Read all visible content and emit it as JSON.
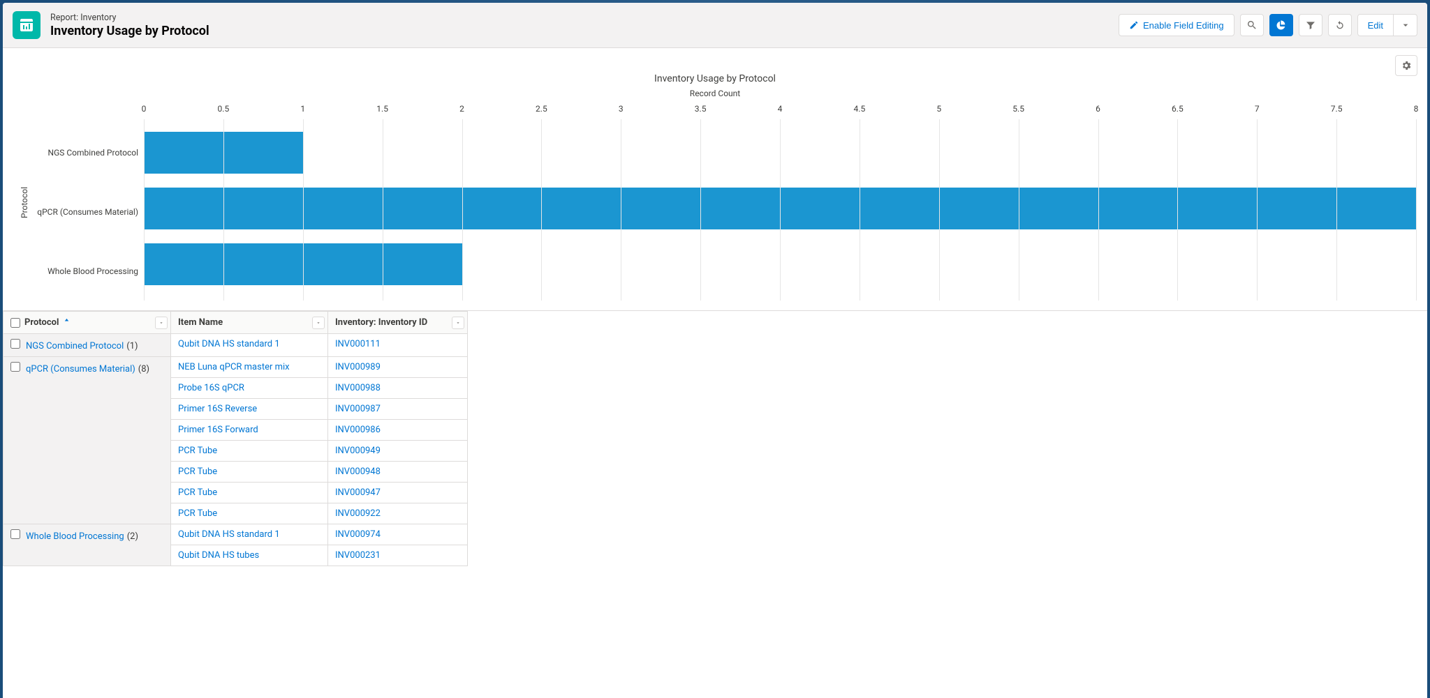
{
  "header": {
    "subtitle": "Report: Inventory",
    "title": "Inventory Usage by Protocol",
    "field_editing_label": "Enable Field Editing",
    "edit_label": "Edit"
  },
  "chart_data": {
    "type": "bar",
    "orientation": "horizontal",
    "title": "Inventory Usage by Protocol",
    "xlabel": "Record Count",
    "ylabel": "Protocol",
    "xlim": [
      0,
      8
    ],
    "ticks": [
      0,
      0.5,
      1,
      1.5,
      2,
      2.5,
      3,
      3.5,
      4,
      4.5,
      5,
      5.5,
      6,
      6.5,
      7,
      7.5,
      8
    ],
    "categories": [
      "NGS Combined Protocol",
      "qPCR (Consumes Material)",
      "Whole Blood Processing"
    ],
    "values": [
      1,
      8,
      2
    ]
  },
  "table": {
    "columns": {
      "protocol": "Protocol",
      "item": "Item Name",
      "inv": "Inventory: Inventory ID"
    },
    "groups": [
      {
        "protocol": "NGS Combined Protocol",
        "count": 1,
        "rows": [
          {
            "item": "Qubit DNA HS standard 1",
            "inv": "INV000111"
          }
        ]
      },
      {
        "protocol": "qPCR (Consumes Material)",
        "count": 8,
        "rows": [
          {
            "item": "NEB Luna qPCR master mix",
            "inv": "INV000989"
          },
          {
            "item": "Probe 16S qPCR",
            "inv": "INV000988"
          },
          {
            "item": "Primer 16S Reverse",
            "inv": "INV000987"
          },
          {
            "item": "Primer 16S Forward",
            "inv": "INV000986"
          },
          {
            "item": "PCR Tube",
            "inv": "INV000949"
          },
          {
            "item": "PCR Tube",
            "inv": "INV000948"
          },
          {
            "item": "PCR Tube",
            "inv": "INV000947"
          },
          {
            "item": "PCR Tube",
            "inv": "INV000922"
          }
        ]
      },
      {
        "protocol": "Whole Blood Processing",
        "count": 2,
        "rows": [
          {
            "item": "Qubit DNA HS standard 1",
            "inv": "INV000974"
          },
          {
            "item": "Qubit DNA HS tubes",
            "inv": "INV000231"
          }
        ]
      }
    ]
  }
}
